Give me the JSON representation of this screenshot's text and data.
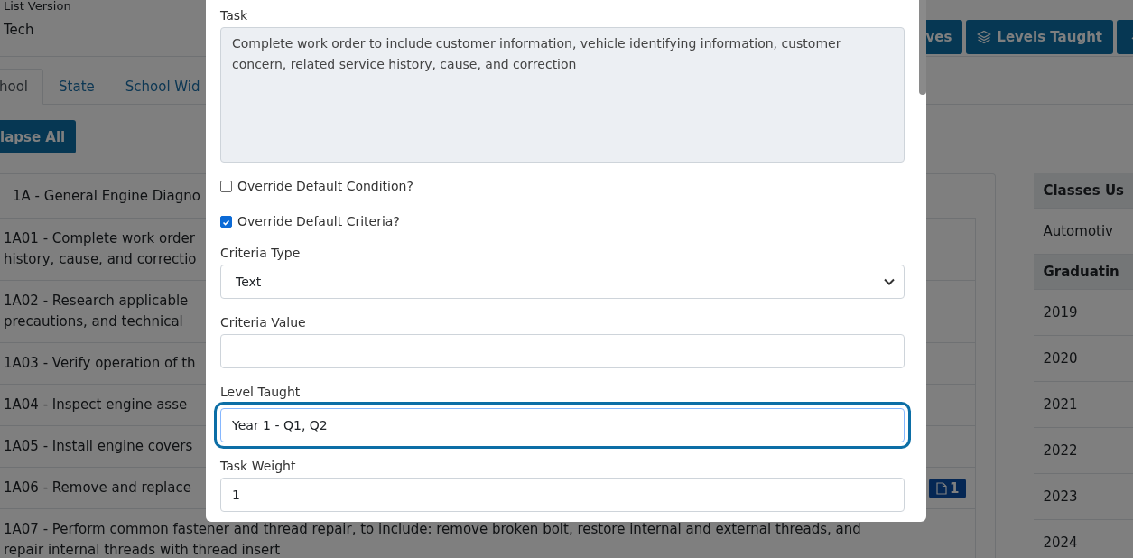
{
  "page": {
    "list_version_label": "List Version",
    "list_version_value": "Tech",
    "toolbar_buttons": [
      {
        "kind": "text",
        "label": "ves"
      },
      {
        "kind": "layers",
        "label": "Levels Taught"
      },
      {
        "kind": "icon-only"
      }
    ],
    "tabs": [
      {
        "label": "hool",
        "selected": true
      },
      {
        "label": "State",
        "selected": false
      },
      {
        "label": "School Wid",
        "selected": false
      }
    ],
    "collapse_button": "lapse All",
    "group_title": "1A - General Engine Diagno",
    "tasks": [
      {
        "lines": [
          "1A01 - Complete work order",
          "history, cause, and correctio"
        ]
      },
      {
        "lines": [
          "1A02 - Research applicable",
          "precautions, and technical"
        ]
      },
      {
        "lines": [
          "1A03 - Verify operation of th"
        ]
      },
      {
        "lines": [
          "1A04 - Inspect engine asse"
        ]
      },
      {
        "lines": [
          "1A05 - Install engine covers"
        ]
      },
      {
        "lines": [
          "1A06 - Remove and replace"
        ],
        "badge": "1"
      },
      {
        "lines": [
          "1A07 - Perform common fastener and thread repair, to include: remove broken bolt, restore internal and external threads, and",
          "repair internal threads with thread insert"
        ]
      }
    ],
    "side_table": [
      {
        "kind": "header",
        "text": "Classes Us"
      },
      {
        "kind": "cell",
        "text": "Automotiv"
      },
      {
        "kind": "header",
        "text": "Graduatin"
      },
      {
        "kind": "cell",
        "text": "2019"
      },
      {
        "kind": "cell",
        "text": "2020"
      },
      {
        "kind": "cell",
        "text": "2021"
      },
      {
        "kind": "cell",
        "text": "2022"
      },
      {
        "kind": "cell",
        "text": "2023"
      },
      {
        "kind": "cell",
        "text": "2024"
      }
    ]
  },
  "modal": {
    "fields": [
      {
        "kind": "textarea",
        "label": "Task",
        "value": "Complete work order to include customer information, vehicle identifying information, customer concern, related service history, cause, and correction",
        "disabled": true
      },
      {
        "kind": "checkbox",
        "label": "Override Default Condition?",
        "checked": false
      },
      {
        "kind": "checkbox",
        "label": "Override Default Criteria?",
        "checked": true
      },
      {
        "kind": "select",
        "label": "Criteria Type",
        "value": "Text"
      },
      {
        "kind": "input",
        "label": "Criteria Value",
        "focused": false
      },
      {
        "kind": "input",
        "label": "Level Taught",
        "value": "Year 1 - Q1, Q2",
        "focused": true
      },
      {
        "kind": "input",
        "label": "Task Weight",
        "value": "1",
        "focused": false
      }
    ]
  }
}
